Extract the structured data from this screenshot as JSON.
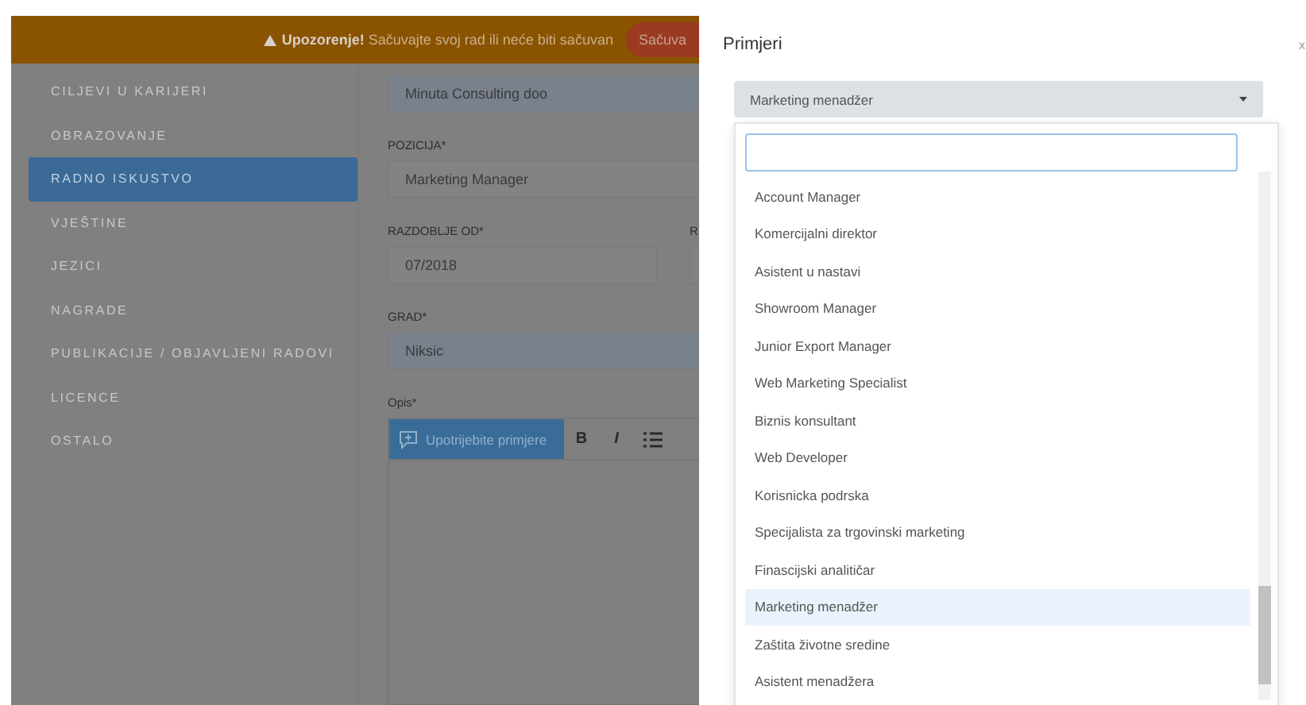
{
  "banner": {
    "message": "**Upozorenje!** Sačuvajte svoj rad ili neće biti sačuvan",
    "button": "Sačuva"
  },
  "sidebar": {
    "items": [
      {
        "label": "CILJEVI U KARIJERI",
        "selected": false
      },
      {
        "label": "OBRAZOVANJE",
        "selected": false
      },
      {
        "label": "RADNO ISKUSTVO",
        "selected": true
      },
      {
        "label": "VJEŠTINE",
        "selected": false
      },
      {
        "label": "JEZICI",
        "selected": false
      },
      {
        "label": "NAGRADE",
        "selected": false
      },
      {
        "label": "PUBLIKACIJE / OBJAVLJENI RADOVI",
        "selected": false
      },
      {
        "label": "LICENCE",
        "selected": false
      },
      {
        "label": "OSTALO",
        "selected": false
      }
    ]
  },
  "form": {
    "company": {
      "value": "Minuta Consulting doo"
    },
    "position": {
      "label": "POZICIJA*",
      "value": "Marketing Manager"
    },
    "period": {
      "label": "RAZDOBLJE OD*",
      "value": "07/2018",
      "label_2": "R"
    },
    "city": {
      "label": "GRAD*",
      "value": "Niksic"
    },
    "description": {
      "label": "Opis*",
      "examples_button": "Upotrijebite primjere",
      "bold": "B",
      "italic": "I"
    }
  },
  "modal": {
    "title": "Primjeri",
    "close": "x",
    "select": {
      "value": "Marketing menadžer"
    },
    "options": [
      {
        "label": "Account Manager",
        "selected": false
      },
      {
        "label": "Komercijalni direktor",
        "selected": false
      },
      {
        "label": "Asistent u nastavi",
        "selected": false
      },
      {
        "label": "Showroom Manager",
        "selected": false
      },
      {
        "label": "Junior Export Manager",
        "selected": false
      },
      {
        "label": "Web Marketing Specialist",
        "selected": false
      },
      {
        "label": "Biznis konsultant",
        "selected": false
      },
      {
        "label": "Web Developer",
        "selected": false
      },
      {
        "label": "Korisnicka podrska",
        "selected": false
      },
      {
        "label": "Specijalista za trgovinski marketing",
        "selected": false
      },
      {
        "label": "Finascijski analitičar",
        "selected": false
      },
      {
        "label": "Marketing menadžer",
        "selected": true
      },
      {
        "label": "Zaštita životne sredine",
        "selected": false
      },
      {
        "label": "Asistent menadžera",
        "selected": false
      }
    ]
  }
}
